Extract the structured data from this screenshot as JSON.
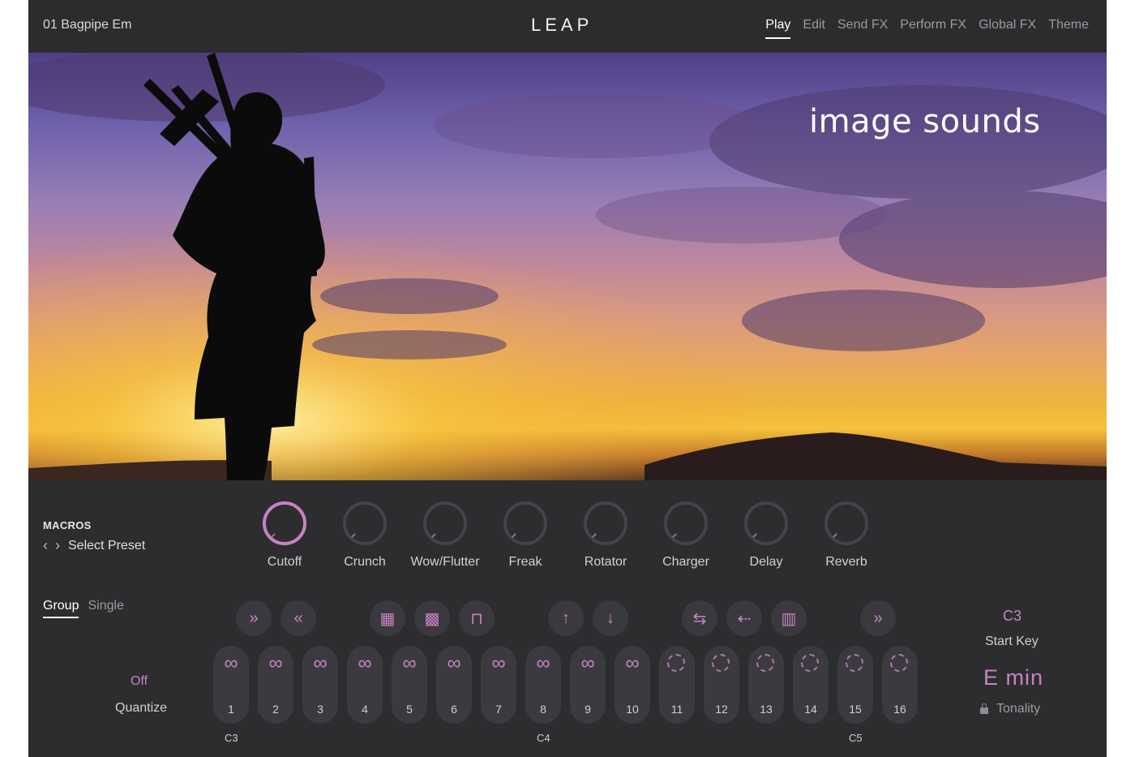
{
  "header": {
    "preset_name": "01 Bagpipe Em",
    "logo": "LEAP",
    "tabs": [
      "Play",
      "Edit",
      "Send FX",
      "Perform FX",
      "Global FX",
      "Theme"
    ],
    "active_tab": "Play"
  },
  "hero": {
    "brand": "image sounds",
    "image_subject": "bagpiper silhouette at sunset"
  },
  "macros": {
    "title": "MACROS",
    "preset_label": "Select Preset",
    "knobs": [
      "Cutoff",
      "Crunch",
      "Wow/Flutter",
      "Freak",
      "Rotator",
      "Charger",
      "Delay",
      "Reverb"
    ],
    "active_knob": "Cutoff"
  },
  "mode": {
    "group": "Group",
    "single": "Single",
    "active": "Group"
  },
  "quantize": {
    "value": "Off",
    "label": "Quantize"
  },
  "actions": [
    {
      "icon": "fast-forward-icon"
    },
    {
      "icon": "rewind-icon"
    },
    {
      "icon": "shuffle-icon"
    },
    {
      "icon": "shuffle-alt-icon"
    },
    {
      "icon": "envelope-icon"
    },
    {
      "icon": "pitch-up-icon"
    },
    {
      "icon": "pitch-down-icon"
    },
    {
      "icon": "reverse-icon"
    },
    {
      "icon": "scatter-icon"
    },
    {
      "icon": "slice-icon"
    },
    {
      "icon": "fast-forward-icon"
    }
  ],
  "pads": {
    "numbers": [
      "1",
      "2",
      "3",
      "4",
      "5",
      "6",
      "7",
      "8",
      "9",
      "10",
      "11",
      "12",
      "13",
      "14",
      "15",
      "16"
    ],
    "loop_symbol": "∞",
    "loop_count": 10,
    "octave_labels": [
      "C3",
      "C4",
      "C5"
    ]
  },
  "start_key": {
    "value": "C3",
    "label": "Start Key"
  },
  "tonality": {
    "value": "E  min",
    "label": "Tonality"
  },
  "colors": {
    "accent": "#c882c4",
    "background": "#2d2d2f",
    "pad": "#3b3b3f"
  }
}
